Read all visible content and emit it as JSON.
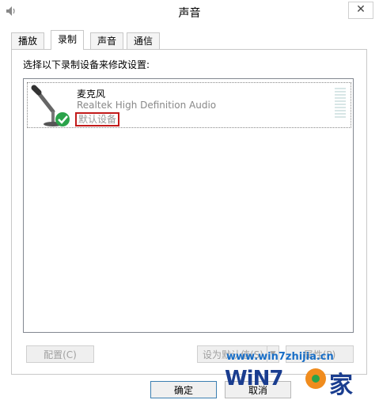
{
  "window": {
    "title": "声音",
    "close_label": "✕"
  },
  "tabs": [
    {
      "label": "播放",
      "active": false
    },
    {
      "label": "录制",
      "active": true
    },
    {
      "label": "声音",
      "active": false
    },
    {
      "label": "通信",
      "active": false
    }
  ],
  "panel": {
    "instruction": "选择以下录制设备来修改设置:",
    "devices": [
      {
        "name": "麦克风",
        "driver": "Realtek High Definition Audio",
        "status": "默认设备",
        "icon": "microphone-icon",
        "default": true
      }
    ]
  },
  "buttons": {
    "configure": "配置(C)",
    "set_default": "设为默认值(S)",
    "properties": "属性(P)",
    "ok": "确定",
    "cancel": "取消"
  },
  "watermark": {
    "url": "www.win7zhijia.cn",
    "brand": "WiN7",
    "char": "家"
  },
  "colors": {
    "status_highlight": "#c21a1a",
    "check_green": "#2aa34a",
    "watermark_blue": "#1a3d8f"
  }
}
